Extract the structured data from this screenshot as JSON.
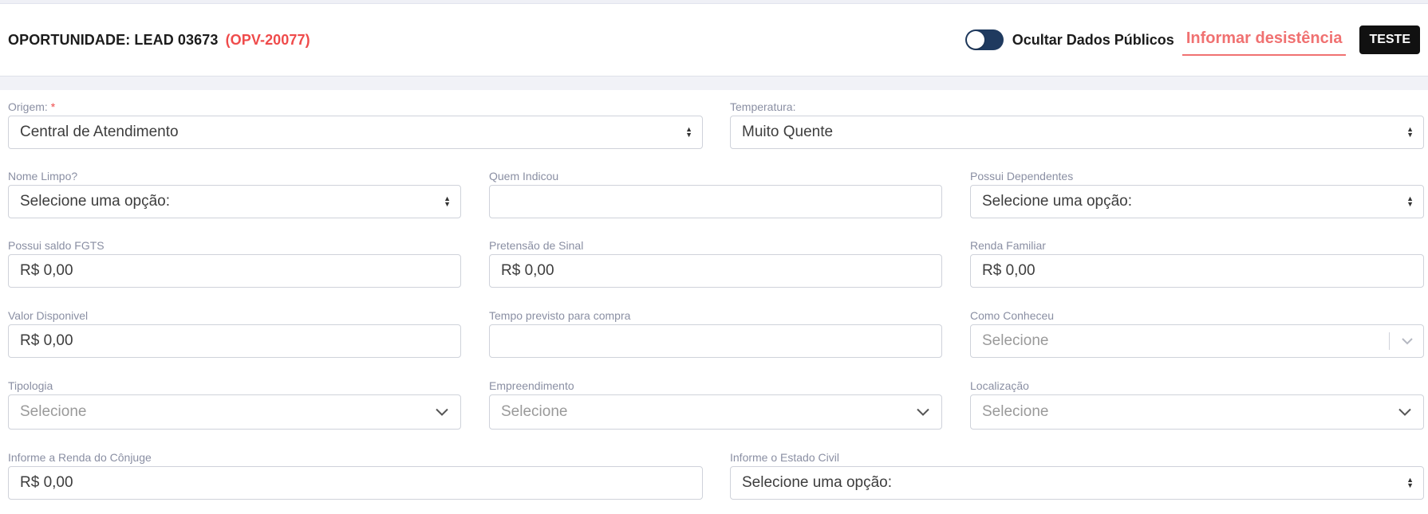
{
  "header": {
    "title": "OPORTUNIDADE: LEAD 03673",
    "code": "(OPV-20077)",
    "toggle_label": "Ocultar Dados Públicos",
    "withdraw_label": "Informar desistência",
    "teste_label": "TESTE"
  },
  "form": {
    "origem": {
      "label": "Origem:",
      "required_mark": "*",
      "value": "Central de Atendimento"
    },
    "temperatura": {
      "label": "Temperatura:",
      "value": "Muito Quente"
    },
    "nome_limpo": {
      "label": "Nome Limpo?",
      "value": "Selecione uma opção:"
    },
    "quem_indicou": {
      "label": "Quem Indicou",
      "value": ""
    },
    "possui_dependentes": {
      "label": "Possui Dependentes",
      "value": "Selecione uma opção:"
    },
    "saldo_fgts": {
      "label": "Possui saldo FGTS",
      "value": "R$ 0,00"
    },
    "pretensao_sinal": {
      "label": "Pretensão de Sinal",
      "value": "R$ 0,00"
    },
    "renda_familiar": {
      "label": "Renda Familiar",
      "value": "R$ 0,00"
    },
    "valor_disponivel": {
      "label": "Valor Disponivel",
      "value": "R$ 0,00"
    },
    "tempo_previsto": {
      "label": "Tempo previsto para compra",
      "value": ""
    },
    "como_conheceu": {
      "label": "Como Conheceu",
      "placeholder": "Selecione"
    },
    "tipologia": {
      "label": "Tipologia",
      "placeholder": "Selecione"
    },
    "empreendimento": {
      "label": "Empreendimento",
      "placeholder": "Selecione"
    },
    "localizacao": {
      "label": "Localização",
      "placeholder": "Selecione"
    },
    "renda_conjuge": {
      "label": "Informe a Renda do Cônjuge",
      "value": "R$ 0,00"
    },
    "estado_civil": {
      "label": "Informe o Estado Civil",
      "value": "Selecione uma opção:"
    }
  }
}
